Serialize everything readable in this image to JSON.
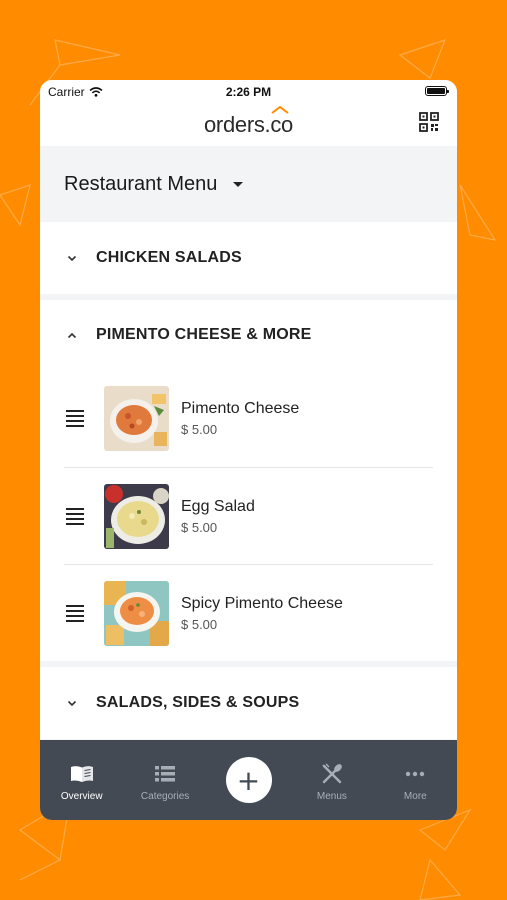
{
  "status_bar": {
    "carrier": "Carrier",
    "time": "2:26 PM"
  },
  "header": {
    "logo_text": "orders.co",
    "qr_icon": "qr-code-icon"
  },
  "menu_selector": {
    "title": "Restaurant Menu"
  },
  "sections": [
    {
      "label": "CHICKEN SALADS",
      "expanded": false
    },
    {
      "label": "PIMENTO CHEESE & MORE",
      "expanded": true,
      "items": [
        {
          "name": "Pimento Cheese",
          "price": "$ 5.00"
        },
        {
          "name": "Egg Salad",
          "price": "$ 5.00"
        },
        {
          "name": "Spicy Pimento Cheese",
          "price": "$ 5.00"
        }
      ]
    },
    {
      "label": "SALADS, SIDES & SOUPS",
      "expanded": false
    }
  ],
  "tab_bar": {
    "tabs": [
      {
        "label": "Overview",
        "icon": "book-icon",
        "active": true
      },
      {
        "label": "Categories",
        "icon": "list-icon",
        "active": false
      },
      {
        "label": "+",
        "icon": "plus-icon"
      },
      {
        "label": "Menus",
        "icon": "utensils-icon",
        "active": false
      },
      {
        "label": "More",
        "icon": "more-dots-icon",
        "active": false
      }
    ]
  },
  "colors": {
    "background": "#FF8C00",
    "tab_bar": "#434A54",
    "accent": "#FF8C00"
  }
}
